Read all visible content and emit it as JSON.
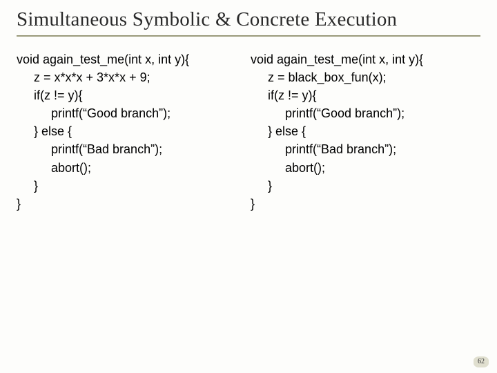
{
  "title": "Simultaneous Symbolic & Concrete Execution",
  "left": {
    "l1": "void again_test_me(int x, int y){",
    "l2": "     z = x*x*x + 3*x*x + 9;",
    "l3": "     if(z != y){",
    "l4": "          printf(“Good branch”);",
    "l5": "     } else {",
    "l6": "          printf(“Bad branch”);",
    "l7": "          abort();",
    "l8": "     }",
    "l9": "}"
  },
  "right": {
    "l1": "void again_test_me(int x, int y){",
    "l2": "     z = black_box_fun(x);",
    "l3": "     if(z != y){",
    "l4": "          printf(“Good branch”);",
    "l5": "     } else {",
    "l6": "          printf(“Bad branch”);",
    "l7": "          abort();",
    "l8": "     }",
    "l9": "}"
  },
  "page": "62"
}
